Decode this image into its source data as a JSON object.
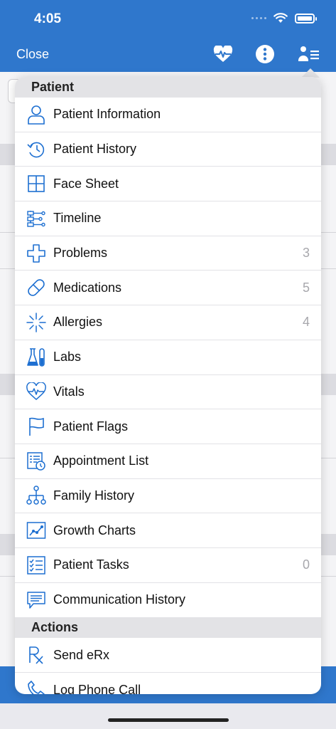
{
  "status": {
    "time": "4:05"
  },
  "nav": {
    "close_label": "Close"
  },
  "colors": {
    "brand": "#2f77cc",
    "icon": "#1d6fd1",
    "count": "#a7a7ac"
  },
  "sections": [
    {
      "title": "Patient",
      "items": [
        {
          "label": "Patient Information",
          "icon": "person-icon",
          "count": ""
        },
        {
          "label": "Patient History",
          "icon": "history-clock-icon",
          "count": ""
        },
        {
          "label": "Face Sheet",
          "icon": "grid-icon",
          "count": ""
        },
        {
          "label": "Timeline",
          "icon": "timeline-icon",
          "count": ""
        },
        {
          "label": "Problems",
          "icon": "medical-cross-icon",
          "count": "3"
        },
        {
          "label": "Medications",
          "icon": "pill-icon",
          "count": "5"
        },
        {
          "label": "Allergies",
          "icon": "allergy-burst-icon",
          "count": "4"
        },
        {
          "label": "Labs",
          "icon": "lab-flask-icon",
          "count": ""
        },
        {
          "label": "Vitals",
          "icon": "heart-pulse-icon",
          "count": ""
        },
        {
          "label": "Patient Flags",
          "icon": "flag-icon",
          "count": ""
        },
        {
          "label": "Appointment List",
          "icon": "appointment-list-icon",
          "count": ""
        },
        {
          "label": "Family History",
          "icon": "family-tree-icon",
          "count": ""
        },
        {
          "label": "Growth Charts",
          "icon": "growth-chart-icon",
          "count": ""
        },
        {
          "label": "Patient Tasks",
          "icon": "checklist-icon",
          "count": "0"
        },
        {
          "label": "Communication History",
          "icon": "chat-bubble-icon",
          "count": ""
        }
      ]
    },
    {
      "title": "Actions",
      "items": [
        {
          "label": "Send eRx",
          "icon": "rx-icon",
          "count": ""
        },
        {
          "label": "Log Phone Call",
          "icon": "phone-icon",
          "count": ""
        }
      ]
    }
  ]
}
